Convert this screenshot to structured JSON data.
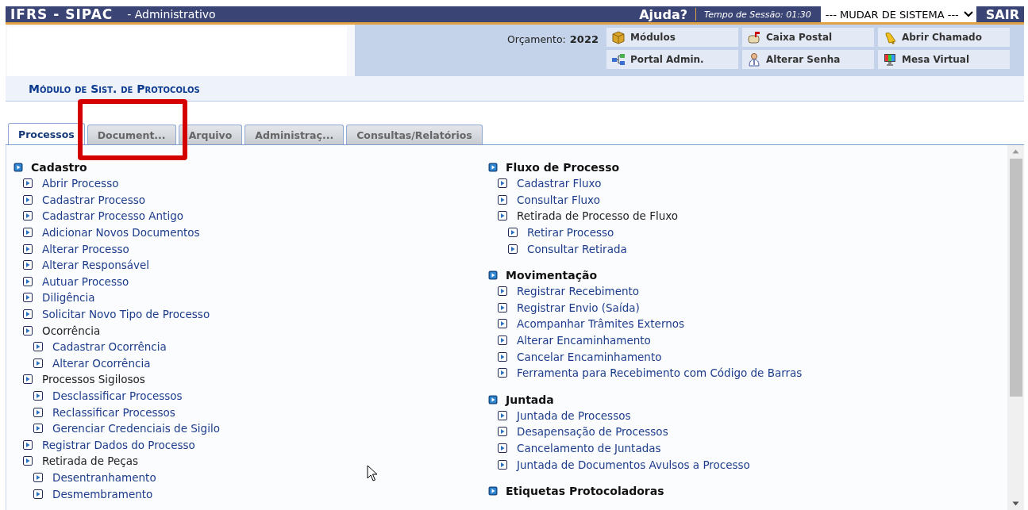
{
  "header": {
    "system": "IFRS - SIPAC",
    "subsystem": "- Administrativo",
    "help": "Ajuda?",
    "session": "Tempo de Sessão: 01:30",
    "system_select": "--- MUDAR DE SISTEMA ---",
    "exit": "SAIR"
  },
  "budget": {
    "label": "Orçamento:",
    "year": "2022"
  },
  "shortcuts": [
    {
      "label": "Módulos"
    },
    {
      "label": "Caixa Postal"
    },
    {
      "label": "Abrir Chamado"
    },
    {
      "label": "Portal Admin."
    },
    {
      "label": "Alterar Senha"
    },
    {
      "label": "Mesa Virtual"
    }
  ],
  "module_title": "Módulo de Sist. de Protocolos",
  "tabs": [
    {
      "label": "Processos",
      "selected": true
    },
    {
      "label": "Document...",
      "selected": false,
      "highlighted": true
    },
    {
      "label": "Arquivo",
      "selected": false
    },
    {
      "label": "Administraç...",
      "selected": false
    },
    {
      "label": "Consultas/Relatórios",
      "selected": false
    }
  ],
  "columns": [
    [
      {
        "title": "Cadastro",
        "items": [
          {
            "kind": "link",
            "label": "Abrir Processo"
          },
          {
            "kind": "link",
            "label": "Cadastrar Processo"
          },
          {
            "kind": "link",
            "label": "Cadastrar Processo Antigo"
          },
          {
            "kind": "link",
            "label": "Adicionar Novos Documentos"
          },
          {
            "kind": "link",
            "label": "Alterar Processo"
          },
          {
            "kind": "link",
            "label": "Alterar Responsável"
          },
          {
            "kind": "link",
            "label": "Autuar Processo"
          },
          {
            "kind": "link",
            "label": "Diligência"
          },
          {
            "kind": "link",
            "label": "Solicitar Novo Tipo de Processo"
          },
          {
            "kind": "group",
            "label": "Ocorrência",
            "children": [
              {
                "kind": "link",
                "label": "Cadastrar Ocorrência"
              },
              {
                "kind": "link",
                "label": "Alterar Ocorrência"
              }
            ]
          },
          {
            "kind": "group",
            "label": "Processos Sigilosos",
            "children": [
              {
                "kind": "link",
                "label": "Desclassificar Processos"
              },
              {
                "kind": "link",
                "label": "Reclassificar Processos"
              },
              {
                "kind": "link",
                "label": "Gerenciar Credenciais de Sigilo"
              }
            ]
          },
          {
            "kind": "link",
            "label": "Registrar Dados do Processo"
          },
          {
            "kind": "group",
            "label": "Retirada de Peças",
            "children": [
              {
                "kind": "link",
                "label": "Desentranhamento"
              },
              {
                "kind": "link",
                "label": "Desmembramento"
              }
            ]
          }
        ]
      }
    ],
    [
      {
        "title": "Fluxo de Processo",
        "items": [
          {
            "kind": "link",
            "label": "Cadastrar Fluxo"
          },
          {
            "kind": "link",
            "label": "Consultar Fluxo"
          },
          {
            "kind": "group",
            "label": "Retirada de Processo de Fluxo",
            "children": [
              {
                "kind": "link",
                "label": "Retirar Processo"
              },
              {
                "kind": "link",
                "label": "Consultar Retirada"
              }
            ]
          }
        ]
      },
      {
        "title": "Movimentação",
        "items": [
          {
            "kind": "link",
            "label": "Registrar Recebimento"
          },
          {
            "kind": "link",
            "label": "Registrar Envio (Saída)"
          },
          {
            "kind": "link",
            "label": "Acompanhar Trâmites Externos"
          },
          {
            "kind": "link",
            "label": "Alterar Encaminhamento"
          },
          {
            "kind": "link",
            "label": "Cancelar Encaminhamento"
          },
          {
            "kind": "link",
            "label": "Ferramenta para Recebimento com Código de Barras"
          }
        ]
      },
      {
        "title": "Juntada",
        "items": [
          {
            "kind": "link",
            "label": "Juntada de Processos"
          },
          {
            "kind": "link",
            "label": "Desapensação de Processos"
          },
          {
            "kind": "link",
            "label": "Cancelamento de Juntadas"
          },
          {
            "kind": "link",
            "label": "Juntada de Documentos Avulsos a Processo"
          }
        ]
      },
      {
        "title": "Etiquetas Protocoladoras"
      }
    ]
  ]
}
